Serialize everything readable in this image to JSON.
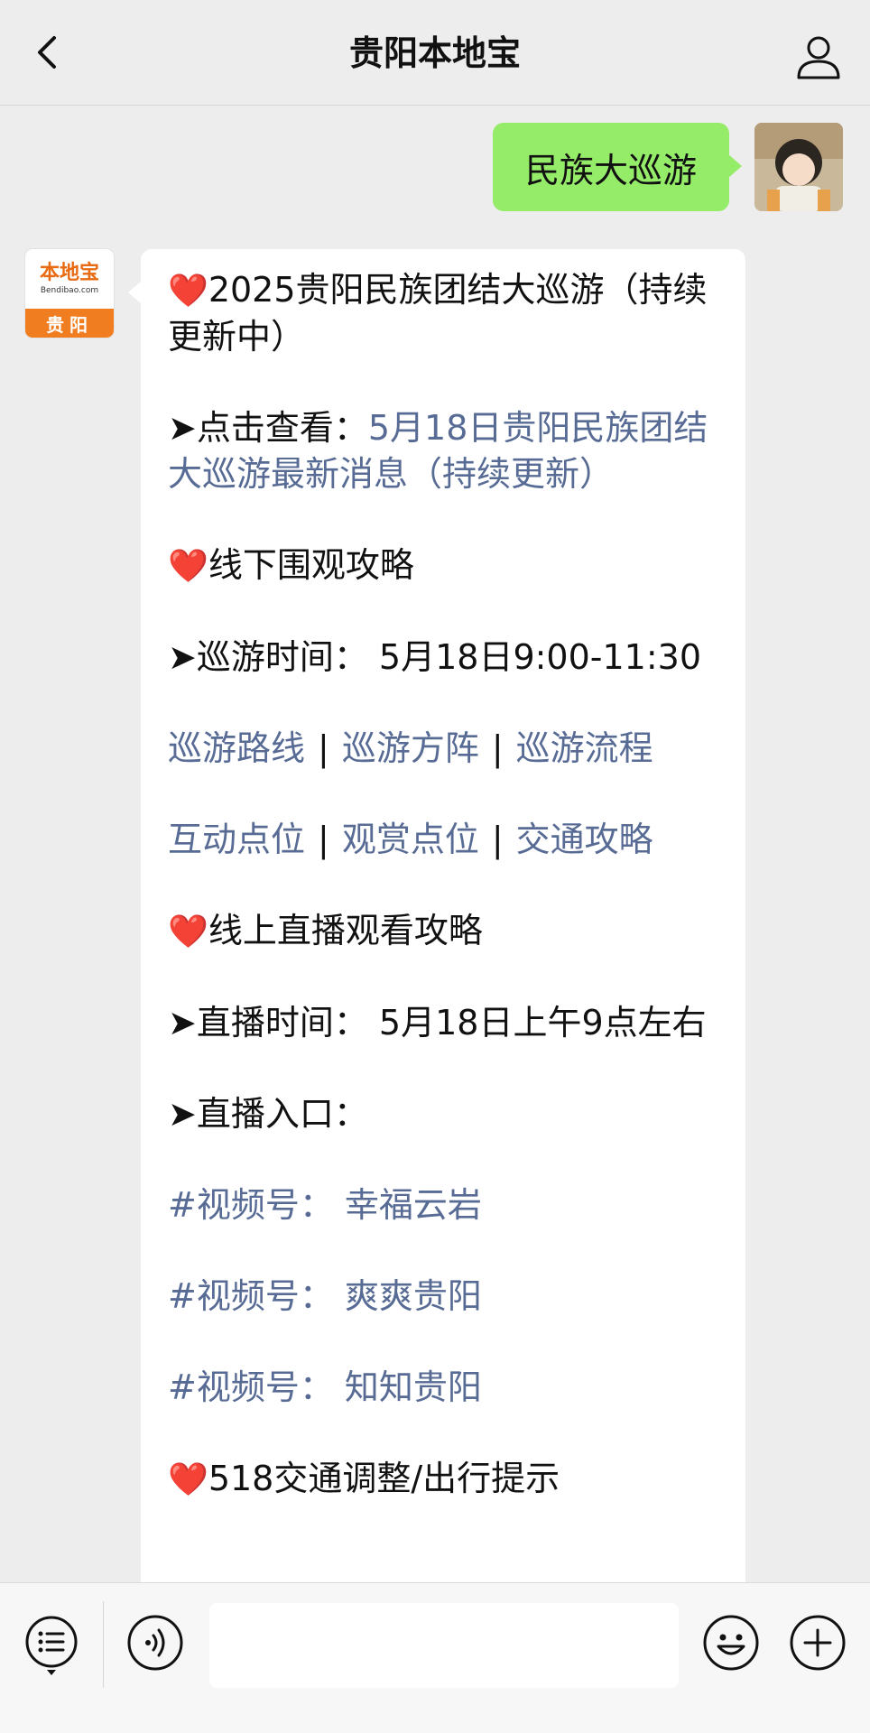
{
  "header": {
    "title": "贵阳本地宝"
  },
  "sent_message": {
    "text": "民族大巡游"
  },
  "sender": {
    "logo_text": "本地宝",
    "logo_sub": "Bendibao.com",
    "logo_city": "贵阳"
  },
  "message": {
    "heart": "❤️",
    "heading1": "2025贵阳民族团结大巡游（持续更新中）",
    "check_prefix": "➤点击查看：",
    "check_link": "5月18日贵阳民族团结大巡游最新消息（持续更新）",
    "heading2": "线下围观攻略",
    "time_line": "➤巡游时间：  5月18日9:00-11:30",
    "links_row1": [
      "巡游路线",
      "巡游方阵",
      "巡游流程"
    ],
    "links_row2": [
      "互动点位",
      "观赏点位",
      "交通攻略"
    ],
    "separator": "|",
    "heading3": "线上直播观看攻略",
    "live_time": "➤直播时间：  5月18日上午9点左右",
    "live_entry": "➤直播入口：",
    "channels": [
      "#视频号：  幸福云岩",
      "#视频号：  爽爽贵阳",
      "#视频号：  知知贵阳"
    ],
    "heading4": "518交通调整/出行提示"
  },
  "colors": {
    "sent_bubble": "#95ec69",
    "link": "#576b95",
    "background": "#ededed"
  },
  "icons": [
    "back-arrow-icon",
    "profile-icon",
    "menu-list-icon",
    "voice-icon",
    "emoji-icon",
    "plus-icon"
  ]
}
